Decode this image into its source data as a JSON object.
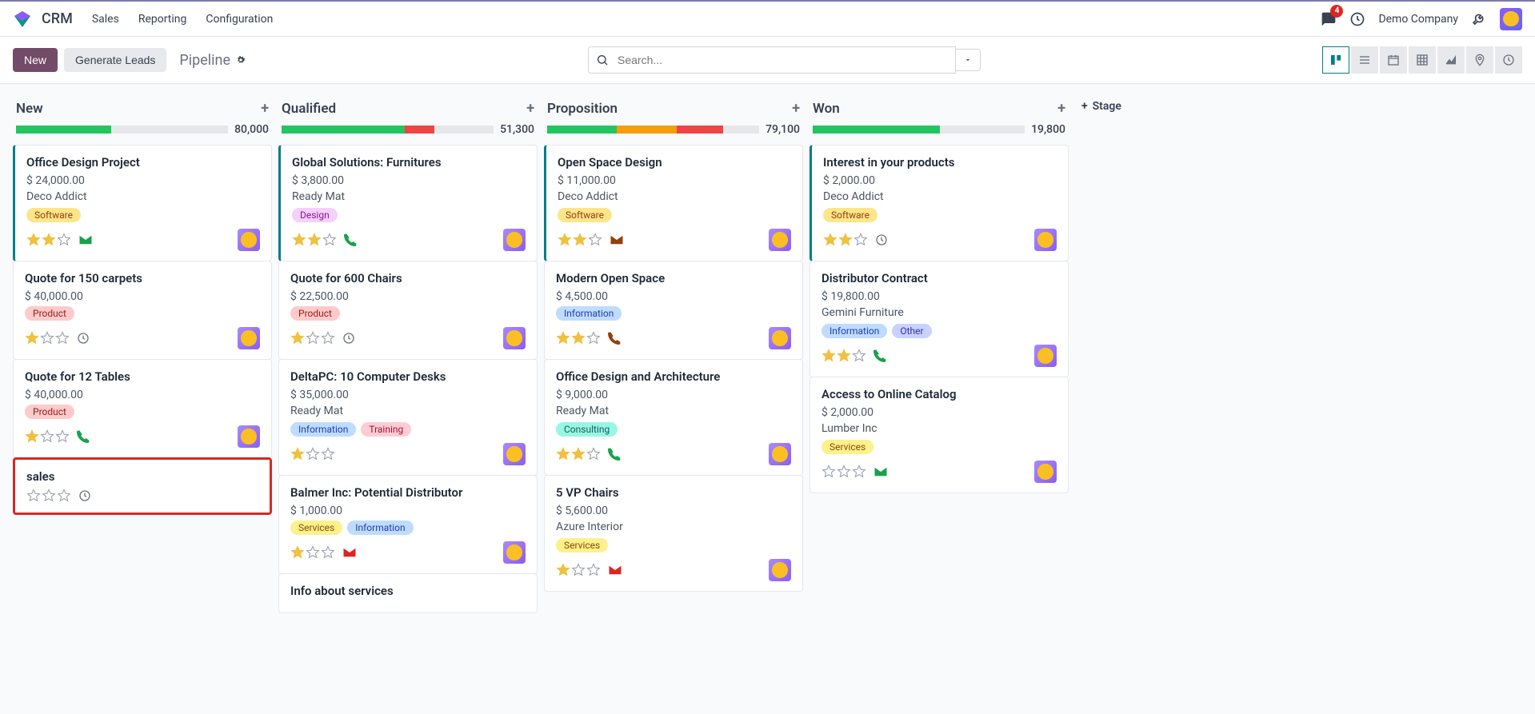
{
  "app": {
    "title": "CRM"
  },
  "nav": {
    "links": [
      "Sales",
      "Reporting",
      "Configuration"
    ]
  },
  "header_right": {
    "msg_count": "4",
    "company": "Demo Company"
  },
  "controls": {
    "new_btn": "New",
    "gen_leads": "Generate Leads",
    "breadcrumb": "Pipeline",
    "search_placeholder": "Search..."
  },
  "add_stage_label": "Stage",
  "tag_classes": {
    "Software": "tag-software",
    "Product": "tag-product",
    "Design": "tag-design",
    "Information": "tag-information",
    "Training": "tag-training",
    "Services": "tag-services",
    "Consulting": "tag-consulting",
    "Other": "tag-other"
  },
  "columns": [
    {
      "title": "New",
      "total": "80,000",
      "bar": [
        [
          "#22c55e",
          45
        ],
        [
          "#e5e7eb",
          55
        ]
      ],
      "cards": [
        {
          "title": "Office Design Project",
          "amount": "$ 24,000.00",
          "company": "Deco Addict",
          "tags": [
            "Software"
          ],
          "stars": 2,
          "icon": "envelope-green",
          "avatar": "a2",
          "active": true
        },
        {
          "title": "Quote for 150 carpets",
          "amount": "$ 40,000.00",
          "company": null,
          "tags": [
            "Product"
          ],
          "stars": 1,
          "icon": "clock",
          "avatar": "a1"
        },
        {
          "title": "Quote for 12 Tables",
          "amount": "$ 40,000.00",
          "company": null,
          "tags": [
            "Product"
          ],
          "stars": 1,
          "icon": "phone-green",
          "avatar": "a1"
        },
        {
          "title": "sales",
          "amount": null,
          "company": null,
          "tags": [],
          "stars": 0,
          "icon": "clock",
          "avatar": null,
          "highlight": true
        }
      ]
    },
    {
      "title": "Qualified",
      "total": "51,300",
      "bar": [
        [
          "#22c55e",
          58
        ],
        [
          "#ef4444",
          14
        ],
        [
          "#e5e7eb",
          28
        ]
      ],
      "cards": [
        {
          "title": "Global Solutions: Furnitures",
          "amount": "$ 3,800.00",
          "company": "Ready Mat",
          "tags": [
            "Design"
          ],
          "stars": 2,
          "icon": "phone-green",
          "avatar": "a1",
          "active": true
        },
        {
          "title": "Quote for 600 Chairs",
          "amount": "$ 22,500.00",
          "company": null,
          "tags": [
            "Product"
          ],
          "stars": 1,
          "icon": "clock",
          "avatar": "a1"
        },
        {
          "title": "DeltaPC: 10 Computer Desks",
          "amount": "$ 35,000.00",
          "company": "Ready Mat",
          "tags": [
            "Information",
            "Training"
          ],
          "stars": 1,
          "icon": null,
          "avatar": "a2"
        },
        {
          "title": "Balmer Inc: Potential Distributor",
          "amount": "$ 1,000.00",
          "company": null,
          "tags": [
            "Services",
            "Information"
          ],
          "stars": 1,
          "icon": "envelope-red",
          "avatar": "a1"
        },
        {
          "title": "Info about services",
          "amount": null,
          "company": null,
          "tags": [],
          "stars": 0,
          "icon": null,
          "avatar": null,
          "partial": true
        }
      ]
    },
    {
      "title": "Proposition",
      "total": "79,100",
      "bar": [
        [
          "#22c55e",
          33
        ],
        [
          "#f59e0b",
          28
        ],
        [
          "#ef4444",
          22
        ],
        [
          "#e5e7eb",
          17
        ]
      ],
      "cards": [
        {
          "title": "Open Space Design",
          "amount": "$ 11,000.00",
          "company": "Deco Addict",
          "tags": [
            "Software"
          ],
          "stars": 2,
          "icon": "envelope-brown",
          "avatar": "a3",
          "active": true
        },
        {
          "title": "Modern Open Space",
          "amount": "$ 4,500.00",
          "company": null,
          "tags": [
            "Information"
          ],
          "stars": 2,
          "icon": "phone-brown",
          "avatar": "a3"
        },
        {
          "title": "Office Design and Architecture",
          "amount": "$ 9,000.00",
          "company": "Ready Mat",
          "tags": [
            "Consulting"
          ],
          "stars": 2,
          "icon": "phone-green",
          "avatar": "a3"
        },
        {
          "title": "5 VP Chairs",
          "amount": "$ 5,600.00",
          "company": "Azure Interior",
          "tags": [
            "Services"
          ],
          "stars": 1,
          "icon": "envelope-red",
          "avatar": "a3"
        }
      ]
    },
    {
      "title": "Won",
      "total": "19,800",
      "bar": [
        [
          "#22c55e",
          60
        ],
        [
          "#e5e7eb",
          40
        ]
      ],
      "cards": [
        {
          "title": "Interest in your products",
          "amount": "$ 2,000.00",
          "company": "Deco Addict",
          "tags": [
            "Software"
          ],
          "stars": 2,
          "icon": "clock",
          "avatar": "a2",
          "active": true
        },
        {
          "title": "Distributor Contract",
          "amount": "$ 19,800.00",
          "company": "Gemini Furniture",
          "tags": [
            "Information",
            "Other"
          ],
          "stars": 2,
          "icon": "phone-green",
          "avatar": "a1"
        },
        {
          "title": "Access to Online Catalog",
          "amount": "$ 2,000.00",
          "company": "Lumber Inc",
          "tags": [
            "Services"
          ],
          "stars": 0,
          "icon": "envelope-green",
          "avatar": "a2"
        }
      ]
    }
  ]
}
